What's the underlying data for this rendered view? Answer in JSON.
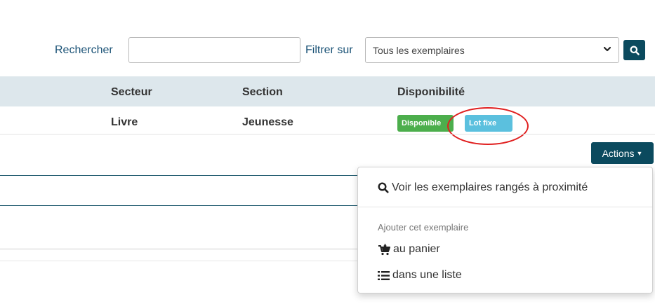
{
  "search": {
    "label": "Rechercher",
    "value": "",
    "placeholder": ""
  },
  "filter": {
    "label": "Filtrer sur",
    "selected": "Tous les exemplaires"
  },
  "table": {
    "headers": [
      "Secteur",
      "Section",
      "Disponibilité"
    ],
    "row": {
      "secteur": "Livre",
      "section": "Jeunesse",
      "badges": [
        "Disponible",
        "Lot fixe"
      ]
    }
  },
  "actions": {
    "label": "Actions"
  },
  "dropdown": {
    "nearby": "Voir les exemplaires rangés à proximité",
    "header": "Ajouter cet exemplaire",
    "cart": "au panier",
    "list": "dans une liste"
  },
  "icons": {
    "search_button": "search-icon",
    "nearby": "search-icon",
    "cart": "cart-icon",
    "list": "list-icon"
  },
  "colors": {
    "primary": "#0b4a5e",
    "label_blue": "#1a5276",
    "badge_green": "#4cae4c",
    "badge_blue": "#5bc0de",
    "highlight_red": "#e02020",
    "header_bg": "#dde7ec"
  }
}
